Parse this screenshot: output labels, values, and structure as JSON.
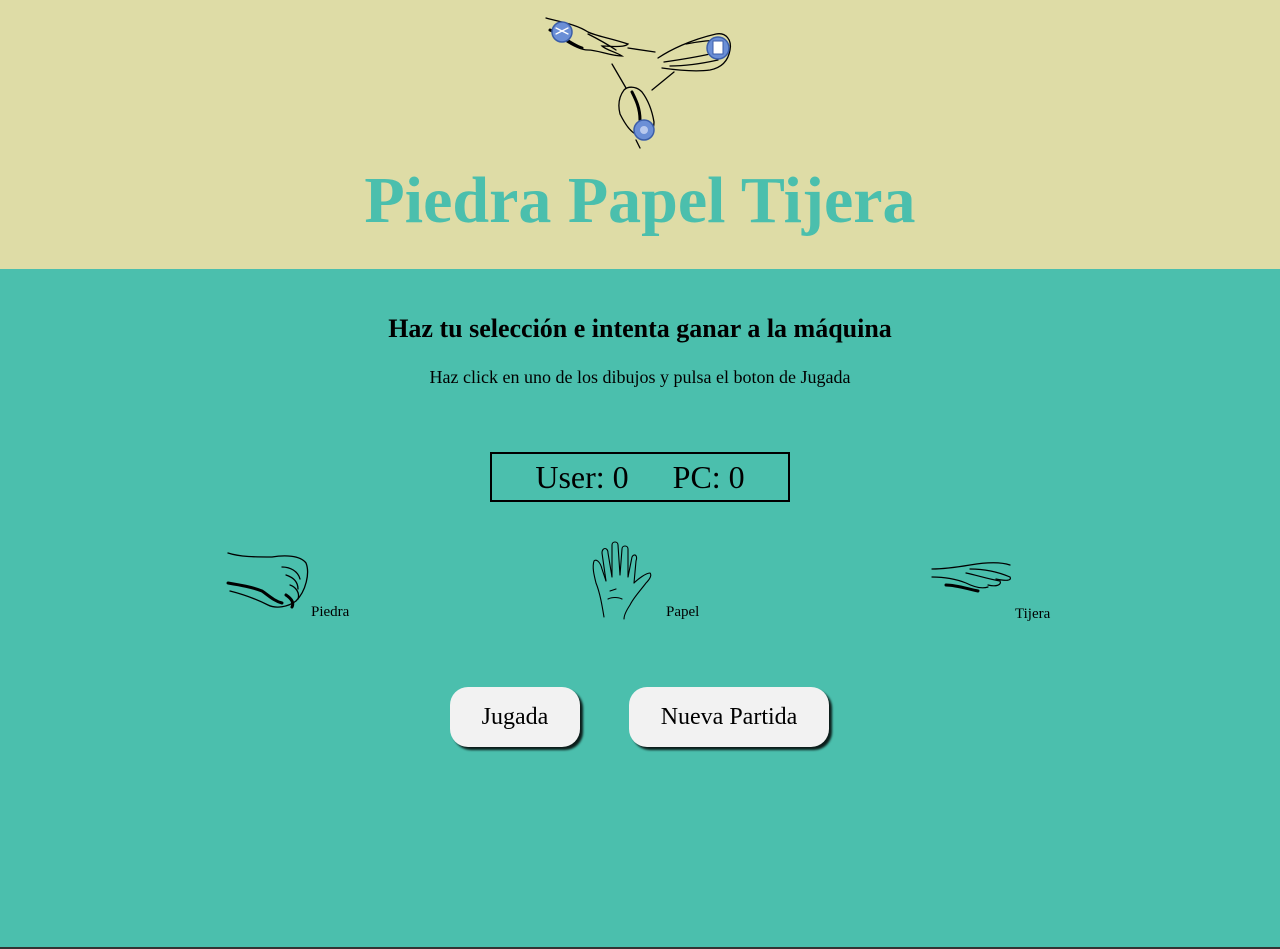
{
  "header": {
    "title": "Piedra Papel Tijera",
    "logo_icon": "rock-paper-scissors-hands-icon"
  },
  "main": {
    "subtitle": "Haz tu selección e intenta ganar a la máquina",
    "instruction": "Haz click en uno de los dibujos y pulsa el boton de Jugada",
    "score": {
      "user_label": "User:",
      "user_value": "0",
      "pc_label": "PC:",
      "pc_value": "0"
    },
    "choices": [
      {
        "label": "Piedra",
        "icon": "fist-icon"
      },
      {
        "label": "Papel",
        "icon": "open-hand-icon"
      },
      {
        "label": "Tijera",
        "icon": "scissors-hand-icon"
      }
    ],
    "buttons": {
      "play": "Jugada",
      "new_game": "Nueva Partida"
    }
  },
  "colors": {
    "header_bg": "#dedca6",
    "main_bg": "#4bbfad",
    "title": "#4bbfad",
    "button_bg": "#f2f2f2",
    "logo_badge": "#6b8fd6"
  }
}
